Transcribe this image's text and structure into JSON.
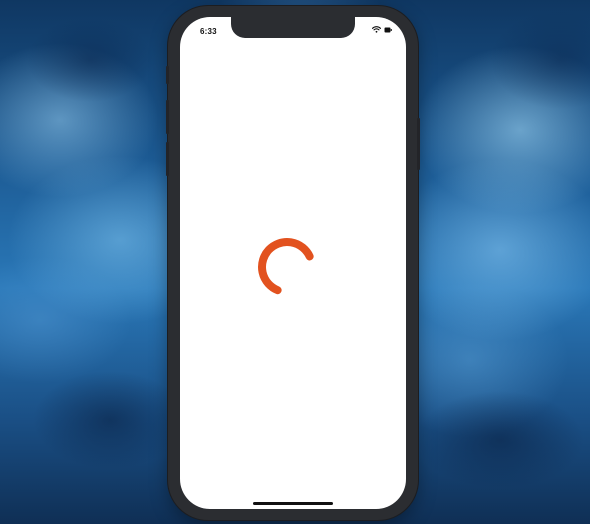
{
  "status_bar": {
    "time": "6:33",
    "icons": [
      "wifi-icon",
      "battery-icon"
    ]
  },
  "loading_indicator": {
    "icon": "loading-spinner-icon",
    "color": "#e2521f"
  },
  "colors": {
    "spinner": "#e2521f",
    "phone_frame": "#2b2d31",
    "screen": "#ffffff",
    "wallpaper": "#1c5a93"
  }
}
